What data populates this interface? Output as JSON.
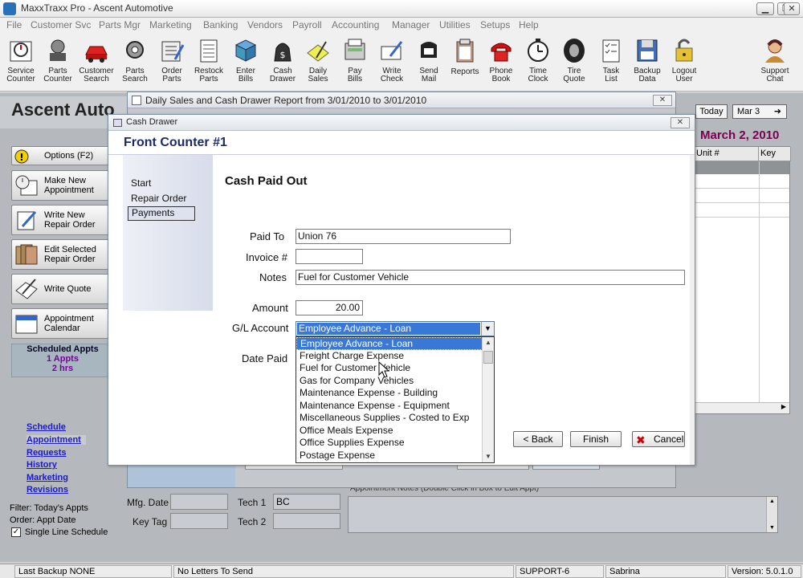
{
  "window": {
    "title": "MaxxTraxx Pro - Ascent Automotive"
  },
  "menu": [
    "File",
    "Customer Svc",
    "Parts Mgr",
    "Marketing",
    "Banking",
    "Vendors",
    "Payroll",
    "Accounting",
    "Manager",
    "Utilities",
    "Setups",
    "Help"
  ],
  "toolbar": [
    {
      "label1": "Service",
      "label2": "Counter",
      "icon": "service-counter-icon"
    },
    {
      "label1": "Parts",
      "label2": "Counter",
      "icon": "parts-counter-icon"
    },
    {
      "label1": "Customer",
      "label2": "Search",
      "icon": "customer-search-icon"
    },
    {
      "label1": "Parts",
      "label2": "Search",
      "icon": "parts-search-icon"
    },
    {
      "label1": "Order",
      "label2": "Parts",
      "icon": "order-parts-icon"
    },
    {
      "label1": "Restock",
      "label2": "Parts",
      "icon": "restock-parts-icon"
    },
    {
      "label1": "Enter",
      "label2": "Bills",
      "icon": "enter-bills-icon"
    },
    {
      "label1": "Cash",
      "label2": "Drawer",
      "icon": "cash-drawer-icon"
    },
    {
      "label1": "Daily",
      "label2": "Sales",
      "icon": "daily-sales-icon"
    },
    {
      "label1": "Pay",
      "label2": "Bills",
      "icon": "pay-bills-icon"
    },
    {
      "label1": "Write",
      "label2": "Check",
      "icon": "write-check-icon"
    },
    {
      "label1": "Send",
      "label2": "Mail",
      "icon": "send-mail-icon"
    },
    {
      "label1": "Reports",
      "label2": "",
      "icon": "reports-icon"
    },
    {
      "label1": "Phone",
      "label2": "Book",
      "icon": "phone-book-icon"
    },
    {
      "label1": "Time",
      "label2": "Clock",
      "icon": "time-clock-icon"
    },
    {
      "label1": "Tire",
      "label2": "Quote",
      "icon": "tire-quote-icon"
    },
    {
      "label1": "Task",
      "label2": "List",
      "icon": "task-list-icon"
    },
    {
      "label1": "Backup",
      "label2": "Data",
      "icon": "backup-data-icon"
    },
    {
      "label1": "Logout",
      "label2": "User",
      "icon": "logout-user-icon"
    },
    {
      "label1": "Support",
      "label2": "Chat",
      "icon": "support-chat-icon"
    }
  ],
  "background": {
    "company": "Ascent Auto",
    "sidebar_buttons": [
      {
        "line1": "Options (F2)",
        "line2": ""
      },
      {
        "line1": "Make  New",
        "line2": "Appointment"
      },
      {
        "line1": "Write New",
        "line2": "Repair Order"
      },
      {
        "line1": "Edit Selected",
        "line2": "Repair Order"
      },
      {
        "line1": "Write Quote",
        "line2": ""
      },
      {
        "line1": "Appointment",
        "line2": "Calendar"
      }
    ],
    "scheduled": {
      "title": "Scheduled Appts",
      "count": "1 Appts",
      "hours": "2 hrs"
    },
    "links": [
      "Schedule",
      "Appointment",
      "Requests",
      "History",
      "Marketing",
      "Revisions"
    ],
    "filter": "Filter: Today's Appts",
    "order": "Order: Appt Date",
    "single_line": "Single Line Schedule",
    "today_btn": "Today",
    "mar3_btn": "Mar 3",
    "date": "March  2, 2010",
    "grid_headers": [
      "Unit #",
      "Key Tag"
    ],
    "mfg_date_label": "Mfg. Date",
    "key_tag_label": "Key Tag",
    "tech1_label": "Tech 1",
    "tech1_value": "BC",
    "tech2_label": "Tech 2",
    "notes_label": "Appointment Notes (Double Click in Box to Edit Appt)"
  },
  "daily_dialog": {
    "title": "Daily Sales and Cash Drawer Report from   3/01/2010   to   3/01/2010"
  },
  "cash_dialog": {
    "title": "Cash Drawer",
    "header": "Front Counter #1",
    "steps": [
      "Start",
      "Repair Order",
      "Payments"
    ],
    "section": "Cash Paid Out",
    "paid_to_label": "Paid To",
    "paid_to": "Union 76",
    "invoice_label": "Invoice #",
    "invoice": "",
    "notes_label": "Notes",
    "notes": "Fuel for Customer Vehicle",
    "amount_label": "Amount",
    "amount": "20.00",
    "gl_label": "G/L Account",
    "gl_selected": "Employee Advance - Loan",
    "date_paid_label": "Date Paid",
    "gl_options": [
      "Employee Advance - Loan",
      "Freight Charge Expense",
      "Fuel for Customer Vehicle",
      "Gas for Company Vehicles",
      "Maintenance Expense - Building",
      "Maintenance Expense - Equipment",
      "Miscellaneous Supplies - Costed to Exp",
      "Office Meals Expense",
      "Office Supplies Expense",
      "Postage Expense"
    ],
    "back_btn": "< Back",
    "finish_btn": "Finish",
    "cancel_btn": "Cancel"
  },
  "status": {
    "backup": "Last Backup NONE",
    "letters": "No Letters To Send",
    "support": "SUPPORT-6",
    "user": "Sabrina",
    "version": "Version:  5.0.1.0"
  },
  "colors": {
    "accent": "#3a78d8",
    "header_text": "#1a2a6a",
    "date_text": "#7a0050",
    "link": "#1a1acc"
  }
}
